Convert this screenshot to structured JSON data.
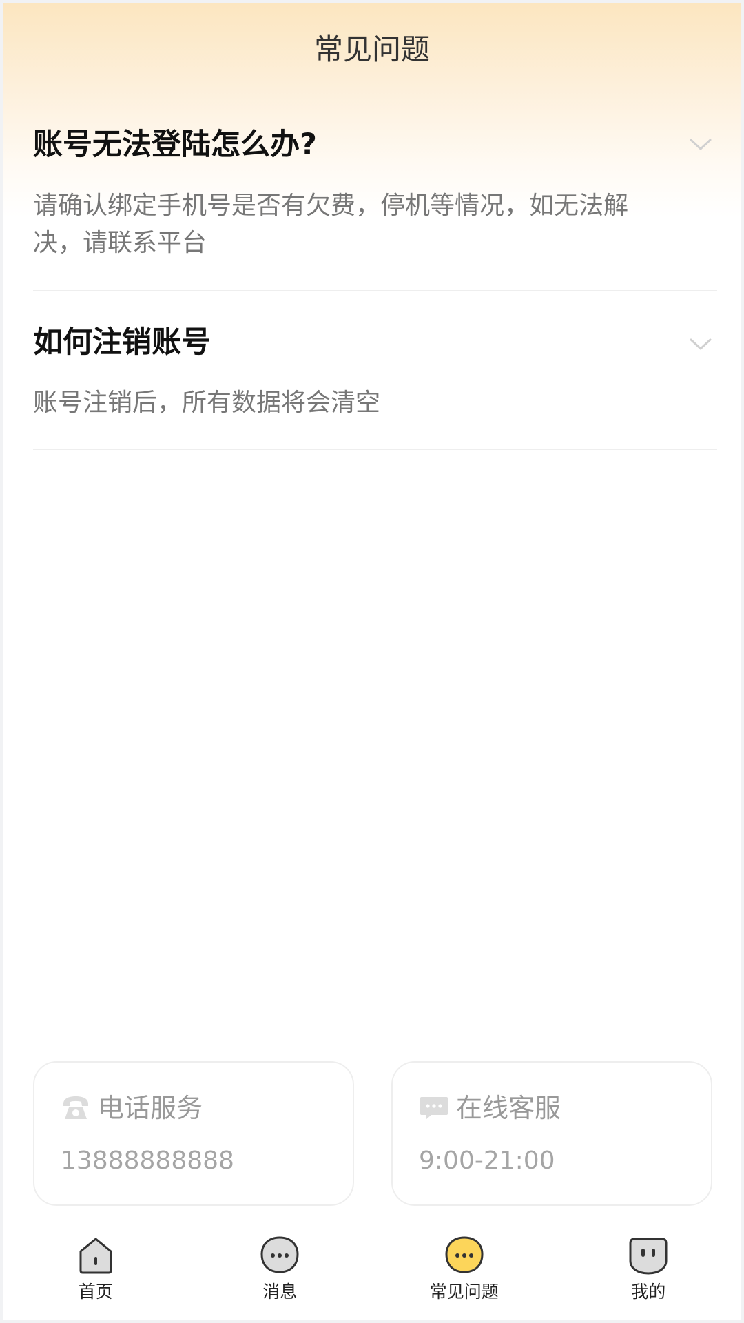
{
  "header": {
    "title": "常见问题"
  },
  "faq": [
    {
      "question": "账号无法登陆怎么办?",
      "answer": "请确认绑定手机号是否有欠费，停机等情况，如无法解决，请联系平台"
    },
    {
      "question": "如何注销账号",
      "answer": "账号注销后，所有数据将会清空"
    }
  ],
  "contact": {
    "phone": {
      "title": "电话服务",
      "value": "13888888888",
      "icon": "phone-icon"
    },
    "online": {
      "title": "在线客服",
      "value": "9:00-21:00",
      "icon": "chat-icon"
    }
  },
  "tabbar": {
    "items": [
      {
        "label": "首页",
        "icon": "home-icon",
        "active": false
      },
      {
        "label": "消息",
        "icon": "message-icon",
        "active": false
      },
      {
        "label": "常见问题",
        "icon": "faq-icon",
        "active": true
      },
      {
        "label": "我的",
        "icon": "profile-icon",
        "active": false
      }
    ]
  },
  "colors": {
    "accent": "#fcd55a",
    "header_gradient": "#fce6c0",
    "text_primary": "#111111",
    "text_secondary": "#777777",
    "text_muted": "#a5a5a5"
  }
}
